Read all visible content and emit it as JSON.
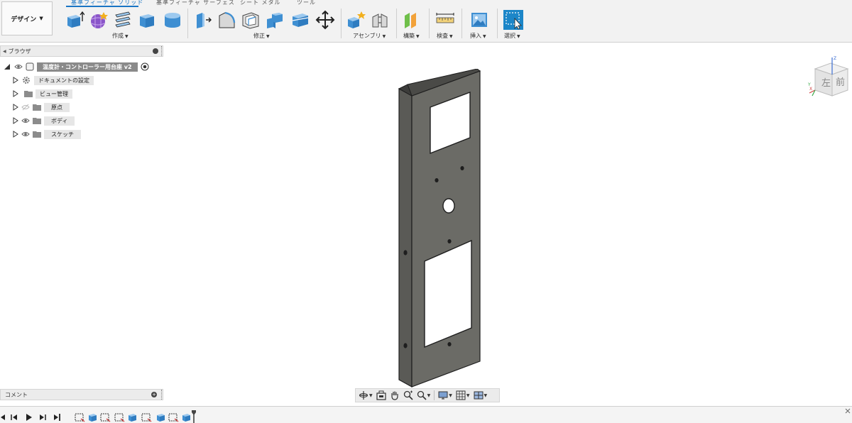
{
  "workspace": {
    "label": "デザイン"
  },
  "tabs": [
    {
      "label": "基準フィーチャ ソリッド",
      "active": true
    },
    {
      "label": "基準フィーチャ サーフェス",
      "active": false
    },
    {
      "label": "シート メタル",
      "active": false
    },
    {
      "label": "ツール",
      "active": false
    }
  ],
  "toolbar_groups": {
    "create": "作成",
    "modify": "修正",
    "assemble": "アセンブリ",
    "construct": "構築",
    "inspect": "検査",
    "insert": "挿入",
    "select": "選択"
  },
  "browser": {
    "title": "ブラウザ",
    "root": "温度計・コントローラー用台座 v2",
    "items": [
      {
        "label": "ドキュメントの設定",
        "icon": "gear-icon"
      },
      {
        "label": "ビュー管理",
        "icon": "folder-icon"
      },
      {
        "label": "原点",
        "icon": "folder-icon"
      },
      {
        "label": "ボディ",
        "icon": "folder-icon"
      },
      {
        "label": "スケッチ",
        "icon": "folder-icon"
      }
    ]
  },
  "viewcube": {
    "left": "左",
    "front": "前",
    "axis_z": "Z",
    "axis_x": "X",
    "axis_y": "Y"
  },
  "comments": {
    "title": "コメント"
  },
  "colors": {
    "accent": "#1a75c4",
    "body": "#6b6b66",
    "select_tile": "#1c86c8"
  },
  "icons": {
    "navbar": [
      "orbit-icon",
      "look-at-icon",
      "pan-icon",
      "zoom-icon",
      "fit-icon",
      "display-settings-icon",
      "grid-icon",
      "viewports-icon"
    ],
    "timeline": [
      "step-first-icon",
      "step-back-icon",
      "play-icon",
      "step-forward-icon",
      "step-last-icon"
    ]
  }
}
